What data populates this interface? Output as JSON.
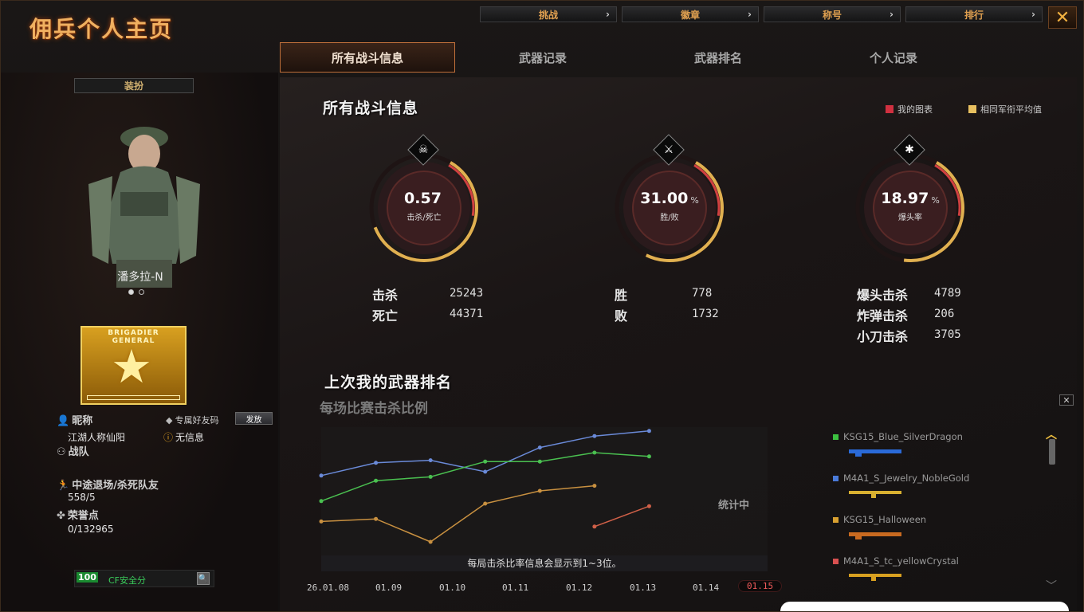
{
  "app": {
    "title": "佣兵个人主页"
  },
  "top_buttons": [
    {
      "label": "挑战"
    },
    {
      "label": "徽章"
    },
    {
      "label": "称号"
    },
    {
      "label": "排行"
    }
  ],
  "close_label": "✕",
  "tabs": [
    {
      "label": "所有战斗信息",
      "active": true
    },
    {
      "label": "武器记录"
    },
    {
      "label": "武器排名"
    },
    {
      "label": "个人记录"
    }
  ],
  "profile": {
    "outfit_label": "装扮",
    "character_name": "潘多拉-N",
    "rank_line1": "BRIGADIER",
    "rank_line2": "GENERAL",
    "nickname_label": "昵称",
    "nickname": "江湖人称仙阳",
    "friend_code_label": "专属好友码",
    "send_label": "发放",
    "team_label": "战队",
    "no_info": "无信息",
    "quit_label": "中途退场/杀死队友",
    "quit_value": "558/5",
    "honor_label": "荣誉点",
    "honor_value": "0/132965",
    "safety_score": "100",
    "safety_label": "CF安全分"
  },
  "overview": {
    "title": "所有战斗信息",
    "legend_mine": "我的图表",
    "legend_avg": "相同军衔平均值",
    "gauges": [
      {
        "value": "0.57",
        "unit": "",
        "label": "击杀/死亡",
        "icon": "skull-icon",
        "glyph": "☠",
        "fill": 0.57
      },
      {
        "value": "31.00",
        "unit": "%",
        "label": "胜/败",
        "icon": "crossed-swords-icon",
        "glyph": "⚔",
        "fill": 0.31
      },
      {
        "value": "18.97",
        "unit": "%",
        "label": "爆头率",
        "icon": "rifle-icon",
        "glyph": "✱",
        "fill": 0.19
      }
    ],
    "stats_col1": [
      {
        "label": "击杀",
        "value": "25243"
      },
      {
        "label": "死亡",
        "value": "44371"
      }
    ],
    "stats_col2": [
      {
        "label": "胜",
        "value": "778"
      },
      {
        "label": "败",
        "value": "1732"
      }
    ],
    "stats_col3": [
      {
        "label": "爆头击杀",
        "value": "4789"
      },
      {
        "label": "炸弹击杀",
        "value": "206"
      },
      {
        "label": "小刀击杀",
        "value": "3705"
      }
    ]
  },
  "weapon_rank": {
    "title": "上次我的武器排名",
    "subtitle": "每场比赛击杀比例",
    "note": "每局击杀比率信息会显示到1~3位。",
    "status": "统计中",
    "close": "✕",
    "weapons": [
      {
        "name": "KSG15_Blue_SilverDragon",
        "color": "#3cc040"
      },
      {
        "name": "M4A1_S_Jewelry_NobleGold",
        "color": "#4a7ad8"
      },
      {
        "name": "KSG15_Halloween",
        "color": "#d8a030"
      },
      {
        "name": "M4A1_S_tc_yellowCrystal",
        "color": "#d85050"
      }
    ]
  },
  "chart_data": {
    "type": "line",
    "categories": [
      "26.01.08",
      "01.09",
      "01.10",
      "01.11",
      "01.12",
      "01.13",
      "01.14",
      "01.15"
    ],
    "active_category": "01.15",
    "series": [
      {
        "color": "#6a8ad8",
        "values": [
          0.62,
          0.72,
          0.74,
          0.65,
          0.84,
          0.93,
          0.97,
          null
        ]
      },
      {
        "color": "#4ac050",
        "values": [
          0.42,
          0.58,
          0.61,
          0.73,
          0.73,
          0.8,
          0.77,
          null
        ]
      },
      {
        "color": "#c89040",
        "values": [
          0.26,
          0.28,
          0.1,
          0.4,
          0.5,
          0.54,
          null,
          null
        ]
      },
      {
        "color": "#d06048",
        "values": [
          null,
          null,
          null,
          null,
          null,
          0.22,
          0.38,
          null
        ]
      }
    ]
  }
}
